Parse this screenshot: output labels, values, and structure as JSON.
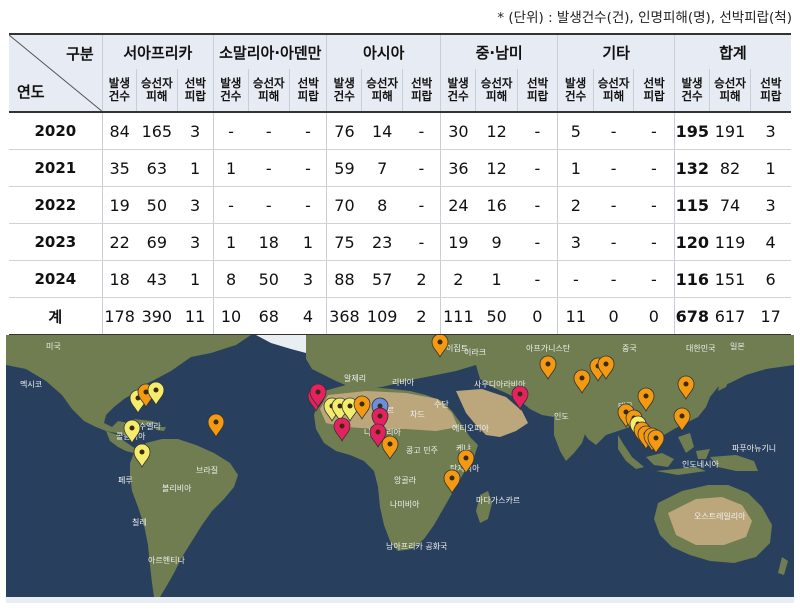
{
  "note": "* (단위) : 발생건수(건), 인명피해(명), 선박피랍(척)",
  "table": {
    "corner_top": "구분",
    "corner_bottom": "연도",
    "regions": [
      "서아프리카",
      "소말리아·아덴만",
      "아시아",
      "중·남미",
      "기타",
      "합계"
    ],
    "subheaders": [
      [
        "발생",
        "건수"
      ],
      [
        "승선자",
        "피해"
      ],
      [
        "선박",
        "피랍"
      ]
    ],
    "rows": [
      {
        "year": "2020",
        "values": [
          "84",
          "165",
          "3",
          "-",
          "-",
          "-",
          "76",
          "14",
          "-",
          "30",
          "12",
          "-",
          "5",
          "-",
          "-",
          "195",
          "191",
          "3"
        ]
      },
      {
        "year": "2021",
        "values": [
          "35",
          "63",
          "1",
          "1",
          "-",
          "-",
          "59",
          "7",
          "-",
          "36",
          "12",
          "-",
          "1",
          "-",
          "-",
          "132",
          "82",
          "1"
        ]
      },
      {
        "year": "2022",
        "values": [
          "19",
          "50",
          "3",
          "-",
          "-",
          "-",
          "70",
          "8",
          "-",
          "24",
          "16",
          "-",
          "2",
          "-",
          "-",
          "115",
          "74",
          "3"
        ]
      },
      {
        "year": "2023",
        "values": [
          "22",
          "69",
          "3",
          "1",
          "18",
          "1",
          "75",
          "23",
          "-",
          "19",
          "9",
          "-",
          "3",
          "-",
          "-",
          "120",
          "119",
          "4"
        ]
      },
      {
        "year": "2024",
        "values": [
          "18",
          "43",
          "1",
          "8",
          "50",
          "3",
          "88",
          "57",
          "2",
          "2",
          "1",
          "-",
          "-",
          "-",
          "-",
          "116",
          "151",
          "6"
        ]
      },
      {
        "year": "계",
        "values": [
          "178",
          "390",
          "11",
          "10",
          "68",
          "4",
          "368",
          "109",
          "2",
          "111",
          "50",
          "0",
          "11",
          "0",
          "0",
          "678",
          "617",
          "17"
        ]
      }
    ]
  },
  "map": {
    "colors": {
      "ocean": "#28405d",
      "land": "#6f7d50",
      "desert": "#bca77c",
      "ice": "#e9eef2",
      "orange": "#f39a12",
      "yellow": "#f4ec6c",
      "red": "#e5225f",
      "blue": "#6a8ee0"
    },
    "labels": [
      "미국",
      "멕시코",
      "베네수엘라",
      "콜롬비아",
      "페루",
      "브라질",
      "볼리비아",
      "칠레",
      "아르헨티나",
      "알제리",
      "리비아",
      "이집트",
      "말리",
      "니제르",
      "나이지리아",
      "차드",
      "수단",
      "에티오피아",
      "케냐",
      "콩고 민주",
      "탄자니아",
      "앙골라",
      "나미비아",
      "남아프리카 공화국",
      "마다가스카르",
      "이라크",
      "사우디아라비아",
      "아프가니스탄",
      "인도",
      "중국",
      "대한민국",
      "일본",
      "태국",
      "인도네시아",
      "파푸아뉴기니",
      "오스트레일리아"
    ]
  }
}
